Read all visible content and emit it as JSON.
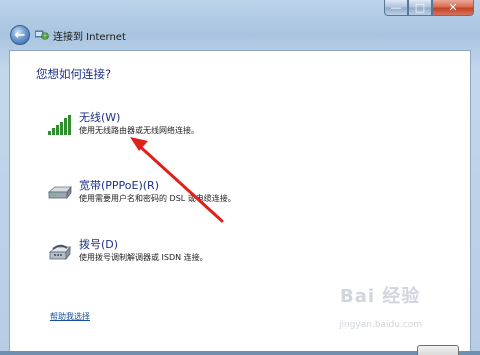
{
  "window": {
    "minimize_glyph": "—",
    "maximize_glyph": "□",
    "close_glyph": "✕"
  },
  "nav": {
    "back_glyph": "←",
    "title": "连接到 Internet",
    "network_icon": "network-globe-icon"
  },
  "main": {
    "question": "您想如何连接?",
    "options": [
      {
        "label": "无线(W)",
        "description": "使用无线路由器或无线网络连接。",
        "icon": "wireless-signal-icon"
      },
      {
        "label": "宽带(PPPoE)(R)",
        "description": "使用需要用户名和密码的 DSL 或电缆连接。",
        "icon": "broadband-modem-icon"
      },
      {
        "label": "拨号(D)",
        "description": "使用拨号调制解调器或 ISDN 连接。",
        "icon": "dialup-phone-icon"
      }
    ],
    "help_link": "帮助我选择"
  },
  "watermark": {
    "logo_text": "Bai 经验",
    "url": "jingyan.baidu.com"
  },
  "colors": {
    "heading": "#1e3287",
    "link": "#1a4fa6",
    "annotation_arrow": "#e0201a"
  }
}
